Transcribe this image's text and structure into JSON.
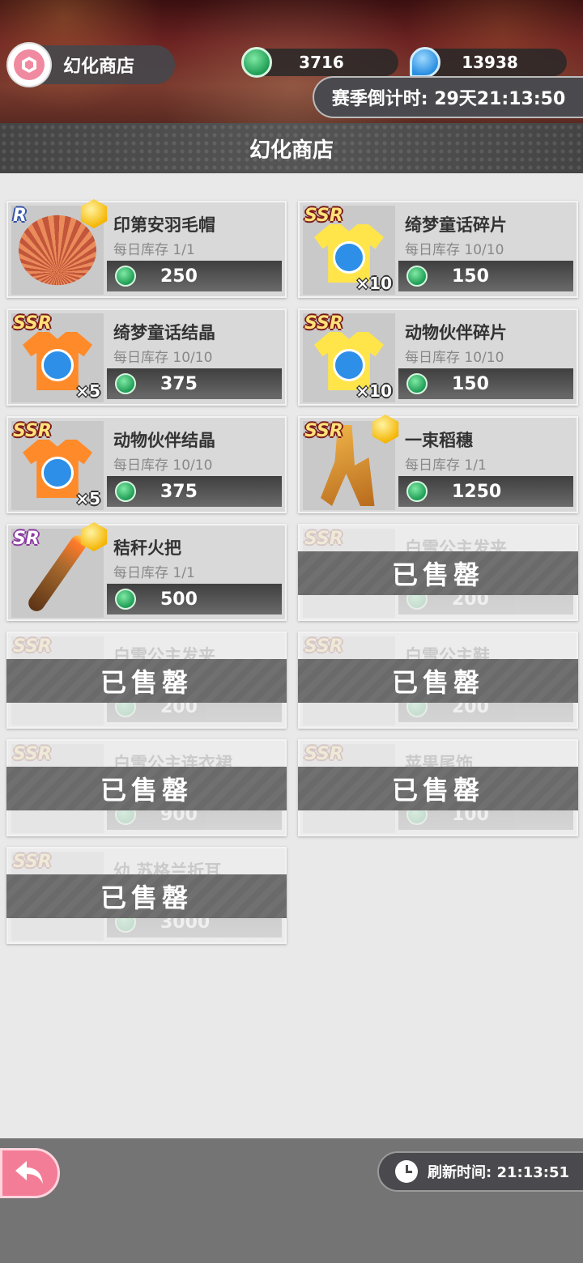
{
  "header": {
    "shop_label": "幻化商店",
    "gem_count": "3716",
    "drop_count": "13938",
    "season_countdown": "赛季倒计时: 29天21:13:50"
  },
  "title": "幻化商店",
  "items": [
    {
      "rarity": "R",
      "name": "印第安羽毛帽",
      "stock": "每日库存 1/1",
      "price": "250",
      "qty": "",
      "sold": false,
      "art": "headdress"
    },
    {
      "rarity": "SSR",
      "name": "绮梦童话碎片",
      "stock": "每日库存 10/10",
      "price": "150",
      "qty": "×10",
      "sold": false,
      "art": "shirt-yellow-carriage"
    },
    {
      "rarity": "SSR",
      "name": "绮梦童话结晶",
      "stock": "每日库存 10/10",
      "price": "375",
      "qty": "×5",
      "sold": false,
      "art": "shirt-orange-carriage"
    },
    {
      "rarity": "SSR",
      "name": "动物伙伴碎片",
      "stock": "每日库存 10/10",
      "price": "150",
      "qty": "×10",
      "sold": false,
      "art": "shirt-yellow-bear"
    },
    {
      "rarity": "SSR",
      "name": "动物伙伴结晶",
      "stock": "每日库存 10/10",
      "price": "375",
      "qty": "×5",
      "sold": false,
      "art": "shirt-orange-bear"
    },
    {
      "rarity": "SSR",
      "name": "一束稻穗",
      "stock": "每日库存 1/1",
      "price": "1250",
      "qty": "",
      "sold": false,
      "art": "wheat"
    },
    {
      "rarity": "SR",
      "name": "秸秆火把",
      "stock": "每日库存 1/1",
      "price": "500",
      "qty": "",
      "sold": false,
      "art": "torch"
    },
    {
      "rarity": "SSR",
      "name": "白雪公主发夹",
      "stock": "",
      "price": "200",
      "qty": "",
      "sold": true,
      "art": "blank"
    },
    {
      "rarity": "SSR",
      "name": "白雪公主发夹",
      "stock": "",
      "price": "200",
      "qty": "",
      "sold": true,
      "art": "blank"
    },
    {
      "rarity": "SSR",
      "name": "白雪公主鞋",
      "stock": "",
      "price": "200",
      "qty": "",
      "sold": true,
      "art": "blank"
    },
    {
      "rarity": "SSR",
      "name": "白雪公主连衣裙",
      "stock": "",
      "price": "900",
      "qty": "",
      "sold": true,
      "art": "blank"
    },
    {
      "rarity": "SSR",
      "name": "苹果尾饰",
      "stock": "",
      "price": "100",
      "qty": "",
      "sold": true,
      "art": "blank"
    },
    {
      "rarity": "SSR",
      "name": "幼 苏格兰折耳",
      "stock": "",
      "price": "3000",
      "qty": "",
      "sold": true,
      "art": "blank"
    }
  ],
  "sold_label": "已售罄",
  "footer": {
    "refresh_label": "刷新时间: 21:13:51"
  },
  "colors": {
    "accent_pink": "#f37d97",
    "gem_green": "#1f9d55",
    "sold_band": "#6a6a6a"
  }
}
